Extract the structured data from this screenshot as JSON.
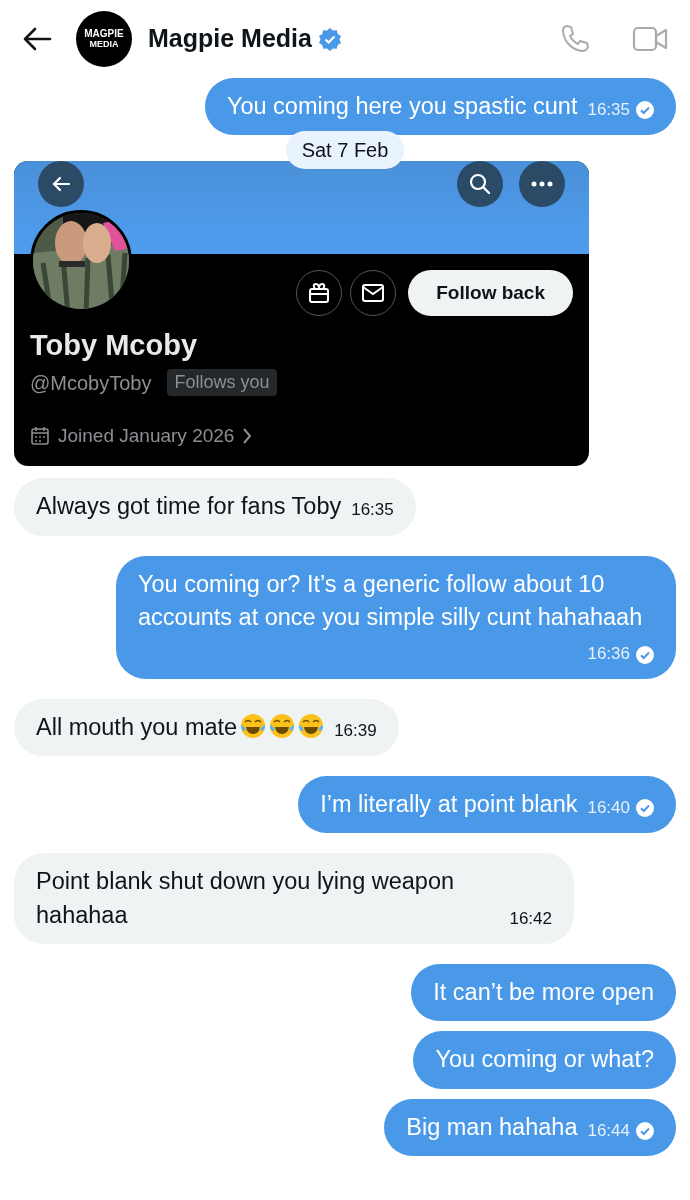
{
  "header": {
    "title": "Magpie Media",
    "verified": true,
    "logo_lines": [
      "MAGPIE",
      "MEDIA"
    ]
  },
  "top_message": {
    "kind": "sent",
    "text": "You coming here you spastic cunt",
    "time": "16:35",
    "read": true
  },
  "date_separator": "Sat 7 Feb",
  "profile_card": {
    "name": "Toby Mcoby",
    "handle": "@McobyToby",
    "follows_you": "Follows you",
    "joined": "Joined January 2026",
    "follow_button": "Follow back"
  },
  "messages": [
    {
      "kind": "received",
      "text": "Always got time for fans Toby",
      "time": "16:35"
    },
    {
      "kind": "sent",
      "text": "You coming or? It’s a generic follow about 10 accounts at once you simple silly cunt hahahaah",
      "time": "16:36",
      "read": true
    },
    {
      "kind": "received",
      "text": "All mouth you mate",
      "emojis": [
        {
          "kind": "tears-of-joy"
        },
        {
          "kind": "tears-of-joy"
        },
        {
          "kind": "tears-of-joy"
        }
      ],
      "time": "16:39"
    },
    {
      "kind": "sent",
      "text": "I’m literally at point blank",
      "time": "16:40",
      "read": true
    },
    {
      "kind": "received",
      "text": "Point blank shut down you lying weapon hahahaa",
      "time": "16:42"
    },
    {
      "kind": "sent",
      "text": "It can’t be more open"
    },
    {
      "kind": "sent",
      "text": "You coming or what?"
    },
    {
      "kind": "sent",
      "text": "Big man hahaha",
      "time": "16:44",
      "read": true
    }
  ]
}
